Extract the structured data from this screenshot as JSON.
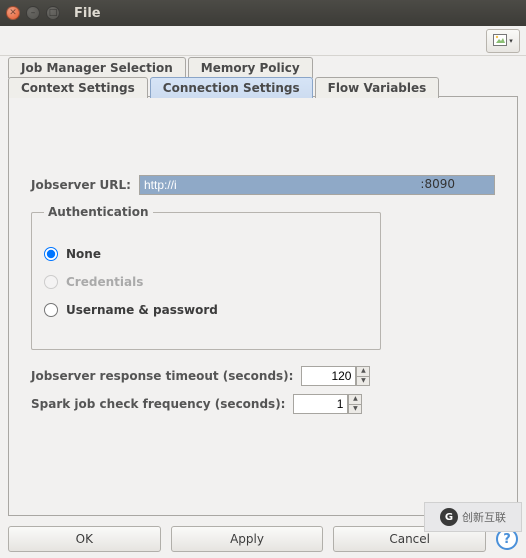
{
  "window": {
    "title": "File"
  },
  "toolbar": {
    "image_icon": "image-icon"
  },
  "tabs": {
    "row1": [
      {
        "label": "Job Manager Selection"
      },
      {
        "label": "Memory Policy"
      }
    ],
    "row2": [
      {
        "label": "Context Settings"
      },
      {
        "label": "Connection Settings"
      },
      {
        "label": "Flow Variables"
      }
    ],
    "active": "Connection Settings"
  },
  "form": {
    "jobserver_url_label": "Jobserver URL:",
    "jobserver_url_value": "http://i",
    "jobserver_url_port": ":8090",
    "auth_legend": "Authentication",
    "auth_options": {
      "none": "None",
      "credentials": "Credentials",
      "username_password": "Username & password"
    },
    "auth_selected": "none",
    "response_timeout_label": "Jobserver response timeout (seconds):",
    "response_timeout_value": "120",
    "check_freq_label": "Spark job check frequency (seconds):",
    "check_freq_value": "1"
  },
  "buttons": {
    "ok": "OK",
    "apply": "Apply",
    "cancel": "Cancel",
    "help": "?"
  },
  "watermark": {
    "text": "创新互联"
  }
}
